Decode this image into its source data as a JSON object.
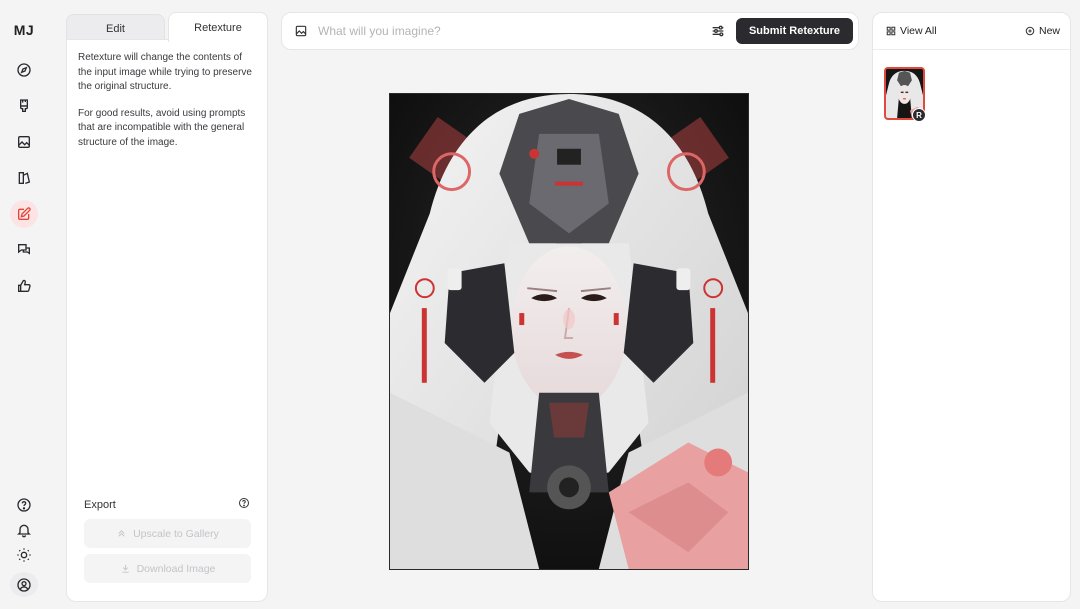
{
  "app": {
    "logo": "MJ"
  },
  "rail": {
    "items": [
      "explore-icon",
      "create-brush-icon",
      "gallery-image-icon",
      "organize-icon",
      "edit-icon",
      "chat-icon",
      "rate-thumbs-up-icon"
    ],
    "active": "edit-icon",
    "bottom": [
      "help-icon",
      "notification-bell-icon",
      "theme-sun-icon",
      "account-icon"
    ]
  },
  "left_panel": {
    "tabs": [
      {
        "label": "Edit"
      },
      {
        "label": "Retexture"
      }
    ],
    "active_tab": "Retexture",
    "description_1": "Retexture will change the contents of the input image while trying to preserve the original structure.",
    "description_2": "For good results, avoid using prompts that are incompatible with the general structure of the image.",
    "export_label": "Export",
    "upscale_label": "Upscale to Gallery",
    "download_label": "Download Image"
  },
  "prompt": {
    "placeholder": "What will you imagine?",
    "value": "",
    "submit_label": "Submit Retexture"
  },
  "right_panel": {
    "view_all_label": "View All",
    "new_label": "New",
    "thumb_badge": "R"
  },
  "colors": {
    "accent": "#e0453c",
    "submit_bg": "#2b2b2f",
    "background": "#f4f4f5"
  }
}
